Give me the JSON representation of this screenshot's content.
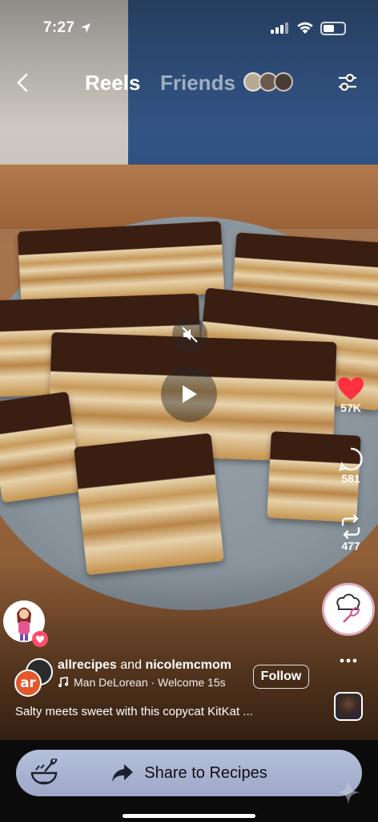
{
  "status_bar": {
    "time": "7:27"
  },
  "header": {
    "back_icon": "chevron-left-icon",
    "tab_active": "Reels",
    "tab_inactive": "Friends",
    "filter_icon": "sliders-icon"
  },
  "video": {
    "mute_icon": "speaker-muted-icon",
    "play_icon": "play-icon"
  },
  "actions": {
    "likes": "57K",
    "comments": "581",
    "reposts": "477"
  },
  "post": {
    "author1": "allrecipes",
    "joiner": "and",
    "author2": "nicolemcmom",
    "avatar_text": "ar",
    "audio": "Man DeLorean · Welcome 15s",
    "follow_label": "Follow",
    "caption": "Salty meets sweet with this copycat KitKat ..."
  },
  "bottom": {
    "share_label": "Share to Recipes"
  },
  "colors": {
    "like": "#ff3040",
    "share_button": "#aab4d1",
    "avatar_badge": "#e2572b"
  }
}
